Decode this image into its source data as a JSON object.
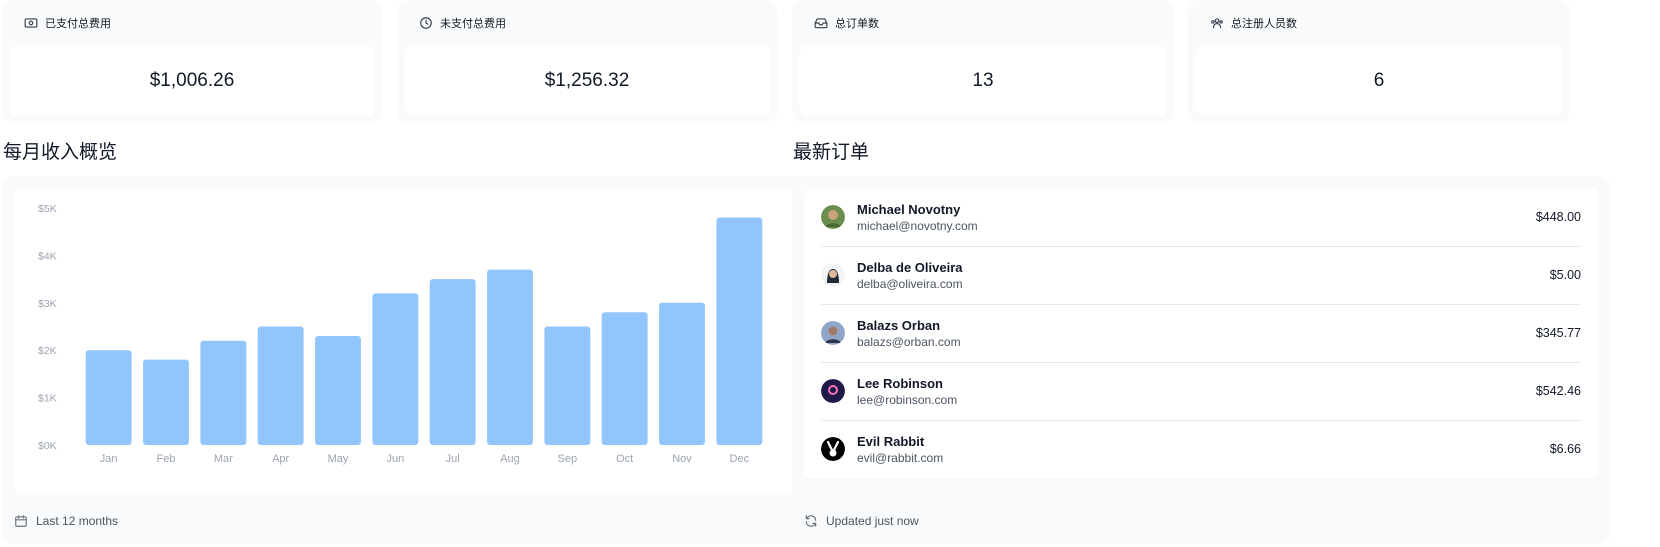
{
  "stats": [
    {
      "label": "已支付总费用",
      "value": "$1,006.26",
      "icon": "banknote-icon"
    },
    {
      "label": "未支付总费用",
      "value": "$1,256.32",
      "icon": "clock-icon"
    },
    {
      "label": "总订单数",
      "value": "13",
      "icon": "inbox-icon"
    },
    {
      "label": "总注册人员数",
      "value": "6",
      "icon": "users-icon"
    }
  ],
  "revenue": {
    "title": "每月收入概览",
    "footer": "Last 12 months",
    "footer_icon": "calendar-icon"
  },
  "chart_data": {
    "type": "bar",
    "categories": [
      "Jan",
      "Feb",
      "Mar",
      "Apr",
      "May",
      "Jun",
      "Jul",
      "Aug",
      "Sep",
      "Oct",
      "Nov",
      "Dec"
    ],
    "values": [
      2000,
      1800,
      2200,
      2500,
      2300,
      3200,
      3500,
      3700,
      2500,
      2800,
      3000,
      4800
    ],
    "yticks": [
      "$0K",
      "$1K",
      "$2K",
      "$3K",
      "$4K",
      "$5K"
    ],
    "ylim": [
      0,
      5000
    ],
    "bar_color": "#93c5fd",
    "grid": false,
    "title": "",
    "xlabel": "",
    "ylabel": ""
  },
  "orders": {
    "title": "最新订单",
    "footer": "Updated just now",
    "footer_icon": "refresh-icon",
    "items": [
      {
        "name": "Michael Novotny",
        "email": "michael@novotny.com",
        "amount": "$448.00"
      },
      {
        "name": "Delba de Oliveira",
        "email": "delba@oliveira.com",
        "amount": "$5.00"
      },
      {
        "name": "Balazs Orban",
        "email": "balazs@orban.com",
        "amount": "$345.77"
      },
      {
        "name": "Lee Robinson",
        "email": "lee@robinson.com",
        "amount": "$542.46"
      },
      {
        "name": "Evil Rabbit",
        "email": "evil@rabbit.com",
        "amount": "$6.66"
      }
    ]
  }
}
